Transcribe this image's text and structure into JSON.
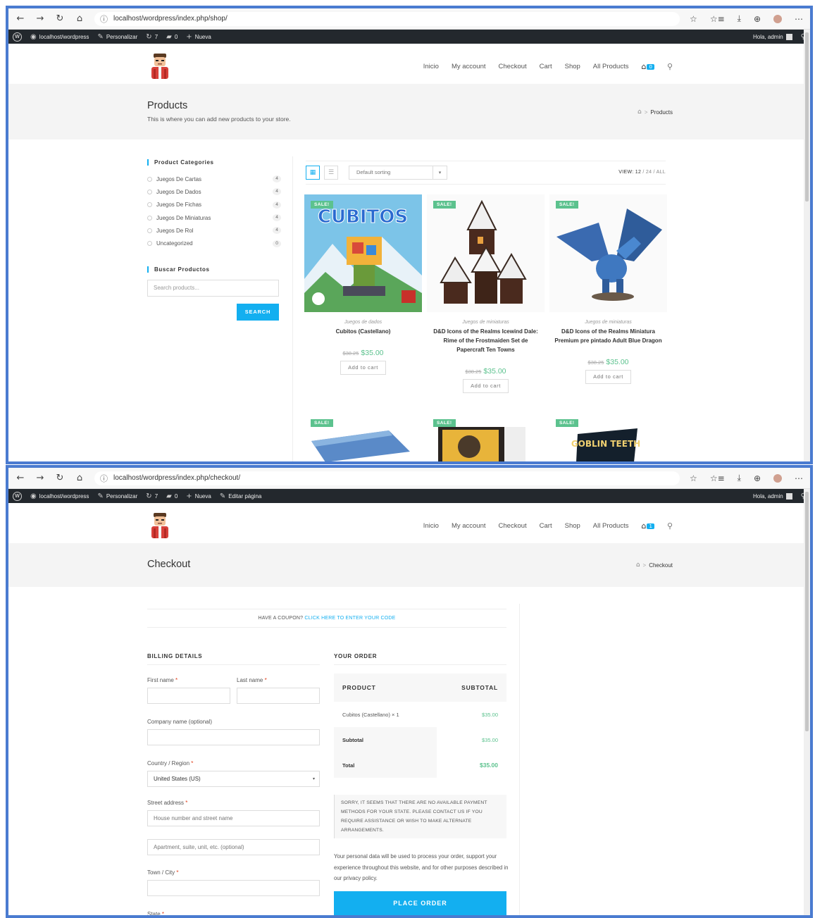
{
  "browser": {
    "nav": {
      "back": "←",
      "forward": "→",
      "reload": "↻",
      "home": "⌂"
    },
    "shop_url": "localhost/wordpress/index.php/shop/",
    "checkout_url": "localhost/wordpress/index.php/checkout/",
    "tools": [
      "☆",
      "☆≡",
      "⤓",
      "⊕",
      "⋯"
    ]
  },
  "adminbar": {
    "site": "localhost/wordpress",
    "customize": "Personalizar",
    "updates": "7",
    "comments": "0",
    "new": "Nueva",
    "edit_page": "Editar página",
    "greeting": "Hola, admin"
  },
  "menu": {
    "items": [
      "Inicio",
      "My account",
      "Checkout",
      "Cart",
      "Shop",
      "All Products"
    ],
    "cart_count_shop": "0",
    "cart_count_checkout": "1"
  },
  "shop": {
    "title": "Products",
    "subtitle": "This is where you can add new products to your store.",
    "breadcrumb": "Products",
    "categories_title": "Product Categories",
    "categories": [
      {
        "name": "Juegos De Cartas",
        "count": "4"
      },
      {
        "name": "Juegos De Dados",
        "count": "4"
      },
      {
        "name": "Juegos De Fichas",
        "count": "4"
      },
      {
        "name": "Juegos De Miniaturas",
        "count": "4"
      },
      {
        "name": "Juegos De Rol",
        "count": "4"
      },
      {
        "name": "Uncategorized",
        "count": "0"
      }
    ],
    "search_title": "Buscar Productos",
    "search_placeholder": "Search products...",
    "search_button": "SEARCH",
    "sorting": "Default sorting",
    "view_label": "VIEW:",
    "view_opts": "12",
    "view_rest": "/ 24 / ALL",
    "sale_badge": "SALE!",
    "add_to_cart": "Add to cart",
    "products": [
      {
        "category": "Juegos de dados",
        "name": "Cubitos (Castellano)",
        "old_price": "$38.25",
        "price": "$35.00",
        "box_title": "CUBITOS"
      },
      {
        "category": "Juegos de miniaturas",
        "name": "D&D Icons of the Realms Icewind Dale: Rime of the Frostmaiden Set de Papercraft Ten Towns",
        "old_price": "$38.25",
        "price": "$35.00"
      },
      {
        "category": "Juegos de miniaturas",
        "name": "D&D Icons of the Realms Miniatura Premium pre pintado Adult Blue Dragon",
        "old_price": "$38.25",
        "price": "$35.00"
      }
    ],
    "more_box_text": "GOBLIN TEETH"
  },
  "checkout": {
    "title": "Checkout",
    "breadcrumb": "Checkout",
    "coupon_text": "HAVE A COUPON?",
    "coupon_link": "CLICK HERE TO ENTER YOUR CODE",
    "billing_title": "BILLING DETAILS",
    "first_name": "First name",
    "last_name": "Last name",
    "company": "Company name (optional)",
    "country": "Country / Region",
    "country_value": "United States (US)",
    "street": "Street address",
    "street_placeholder": "House number and street name",
    "apartment_placeholder": "Apartment, suite, unit, etc. (optional)",
    "town": "Town / City",
    "state": "State",
    "required_mark": "*",
    "order_title": "YOUR ORDER",
    "col_product": "PRODUCT",
    "col_subtotal": "SUBTOTAL",
    "item": "Cubitos (Castellano)  × 1",
    "item_amount": "$35.00",
    "subtotal_label": "Subtotal",
    "subtotal_amount": "$35.00",
    "total_label": "Total",
    "total_amount": "$35.00",
    "payment_notice": "SORRY, IT SEEMS THAT THERE ARE NO AVAILABLE PAYMENT METHODS FOR YOUR STATE. PLEASE CONTACT US IF YOU REQUIRE ASSISTANCE OR WISH TO MAKE ALTERNATE ARRANGEMENTS.",
    "privacy_text": "Your personal data will be used to process your order, support your experience throughout this website, and for other purposes described in our privacy policy.",
    "place_order": "PLACE ORDER"
  },
  "icons": {
    "home": "⌂",
    "cart": "⌂",
    "search": "⚲",
    "grid": "▦",
    "list": "☰",
    "caret": "▾",
    "info": "ⓘ"
  },
  "colors": {
    "accent": "#13aff0",
    "sale": "#5cc28e",
    "frame": "#4a7bd0",
    "adminbar": "#23282d"
  }
}
